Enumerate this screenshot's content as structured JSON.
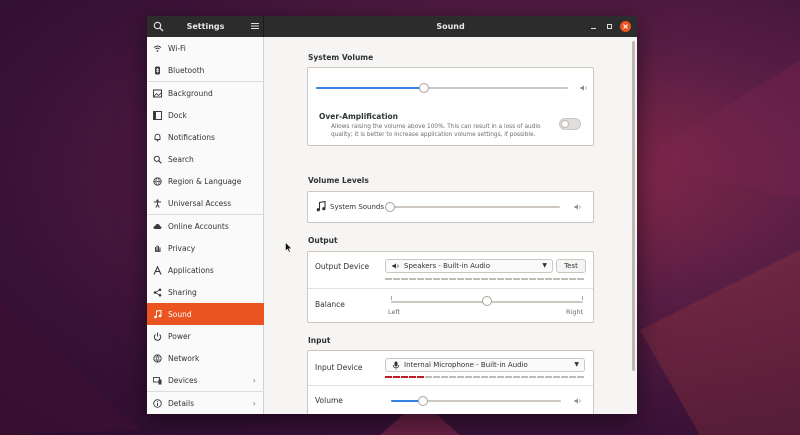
{
  "titlebar": {
    "left_title": "Settings",
    "right_title": "Sound"
  },
  "sidebar": {
    "items": [
      {
        "label": "Wi-Fi",
        "icon": "wifi-icon"
      },
      {
        "label": "Bluetooth",
        "icon": "bluetooth-icon"
      },
      {
        "label": "Background",
        "icon": "background-icon"
      },
      {
        "label": "Dock",
        "icon": "dock-icon"
      },
      {
        "label": "Notifications",
        "icon": "bell-icon"
      },
      {
        "label": "Search",
        "icon": "search-icon"
      },
      {
        "label": "Region & Language",
        "icon": "globe-icon"
      },
      {
        "label": "Universal Access",
        "icon": "accessibility-icon"
      },
      {
        "label": "Online Accounts",
        "icon": "cloud-icon"
      },
      {
        "label": "Privacy",
        "icon": "hand-icon"
      },
      {
        "label": "Applications",
        "icon": "applications-icon"
      },
      {
        "label": "Sharing",
        "icon": "share-icon"
      },
      {
        "label": "Sound",
        "icon": "music-note-icon",
        "active": true
      },
      {
        "label": "Power",
        "icon": "power-icon"
      },
      {
        "label": "Network",
        "icon": "network-icon"
      },
      {
        "label": "Devices",
        "icon": "devices-icon"
      },
      {
        "label": "Details",
        "icon": "info-icon"
      }
    ]
  },
  "sound": {
    "system_volume": {
      "title": "System Volume",
      "level": 0.43,
      "over_amp_title": "Over-Amplification",
      "over_amp_desc": "Allows raising the volume above 100%. This can result in a loss of audio quality; it is better to increase application volume settings, if possible.",
      "over_amp_enabled": false
    },
    "volume_levels": {
      "title": "Volume Levels",
      "system_sounds_label": "System Sounds",
      "system_sounds_level": 0.0
    },
    "output": {
      "title": "Output",
      "device_label": "Output Device",
      "device_value": "Speakers - Built-in Audio",
      "test_label": "Test",
      "balance_label": "Balance",
      "balance_left": "Left",
      "balance_right": "Right",
      "balance_value": 0.5
    },
    "input": {
      "title": "Input",
      "device_label": "Input Device",
      "device_value": "Internal Microphone - Built-in Audio",
      "volume_label": "Volume",
      "volume_level": 0.19
    }
  },
  "colors": {
    "accent": "#e95420",
    "slider_fill": "#3584e4",
    "titlebar": "#2c2c2c",
    "mic_level": "#c01c28"
  }
}
